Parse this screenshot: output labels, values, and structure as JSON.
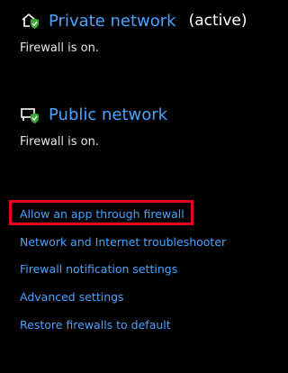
{
  "private_network": {
    "name": "Private network",
    "active_label": "(active)",
    "status": "Firewall is on.",
    "icon": "home-network-shield-icon"
  },
  "public_network": {
    "name": "Public network",
    "status": "Firewall is on.",
    "icon": "public-network-shield-icon"
  },
  "links": [
    "Allow an app through firewall",
    "Network and Internet troubleshooter",
    "Firewall notification settings",
    "Advanced settings",
    "Restore firewalls to default"
  ],
  "colors": {
    "background": "#000000",
    "link": "#4aa3ff",
    "highlight": "#e8001c",
    "shield_ok": "#3aa832"
  }
}
